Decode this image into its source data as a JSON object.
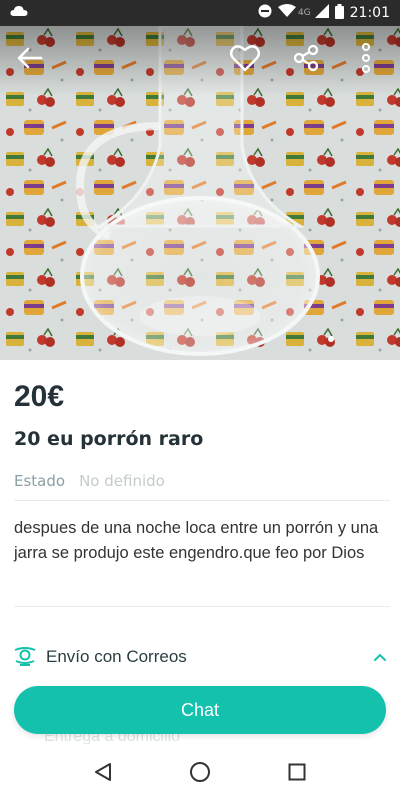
{
  "status_bar": {
    "time": "21:01",
    "network": "4G",
    "icons": [
      "cloud-icon",
      "do-not-disturb-icon",
      "wifi-icon",
      "signal-icon",
      "battery-icon"
    ]
  },
  "header": {
    "back_icon": "arrow-left-icon",
    "favorite_icon": "heart-icon",
    "share_icon": "share-icon",
    "more_icon": "more-vertical-icon"
  },
  "product": {
    "price": "20€",
    "title": "20 eu porrón raro",
    "state_label": "Estado",
    "state_value": "No definido",
    "description": "despues de una noche loca entre un porrón y una jarra se produjo este engendro.que feo por Dios"
  },
  "shipping": {
    "label": "Envío con Correos",
    "partial_item": "Entrega a domicilio"
  },
  "actions": {
    "chat_label": "Chat"
  },
  "colors": {
    "accent": "#13c1ac",
    "text_dark": "#253238",
    "status_bar_bg": "#2b2b2b"
  }
}
